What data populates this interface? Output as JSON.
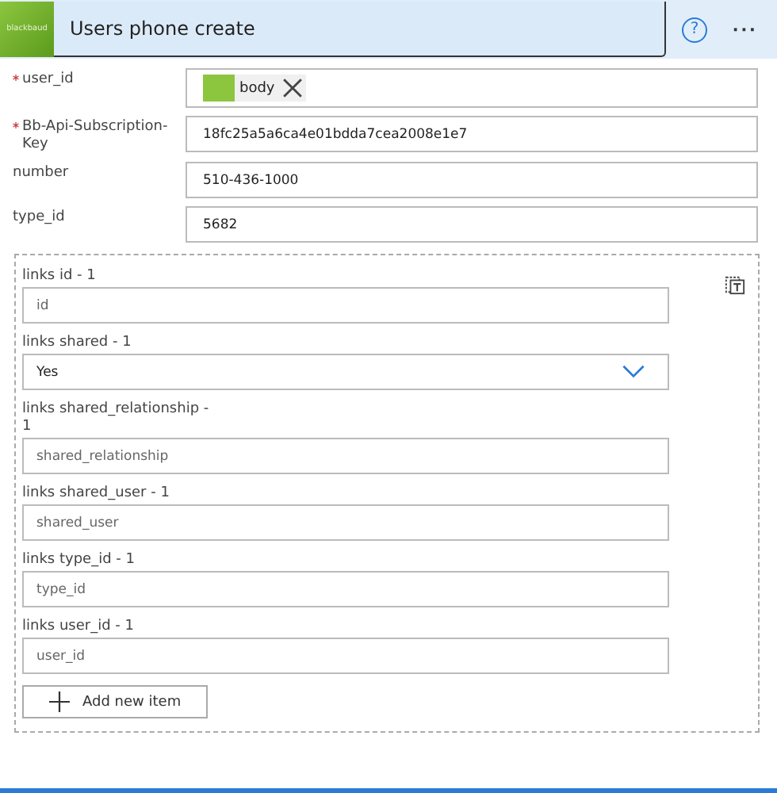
{
  "header": {
    "logo_text": "blackbaud",
    "title": "Users phone create",
    "help_icon": "?",
    "more_icon": "···"
  },
  "fields": [
    {
      "label": "user_id",
      "required": true,
      "kind": "token",
      "value": "body"
    },
    {
      "label": "Bb-Api-Subscription-Key",
      "required": true,
      "kind": "text",
      "value": "18fc25a5a6ca4e01bdda7cea2008e1e7"
    },
    {
      "label": "number",
      "required": false,
      "kind": "text",
      "value": "510-436-1000"
    },
    {
      "label": "type_id",
      "required": false,
      "kind": "text",
      "value": "5682"
    }
  ],
  "links": [
    {
      "label": "links id - 1",
      "kind": "text",
      "placeholder": "id"
    },
    {
      "label": "links shared - 1",
      "kind": "select",
      "value": "Yes"
    },
    {
      "label": "links shared_relationship - 1",
      "kind": "text",
      "placeholder": "shared_relationship"
    },
    {
      "label": "links shared_user - 1",
      "kind": "text",
      "placeholder": "shared_user"
    },
    {
      "label": "links type_id - 1",
      "kind": "text",
      "placeholder": "type_id"
    },
    {
      "label": "links user_id - 1",
      "kind": "text",
      "placeholder": "user_id"
    }
  ],
  "add_button": "Add new item"
}
